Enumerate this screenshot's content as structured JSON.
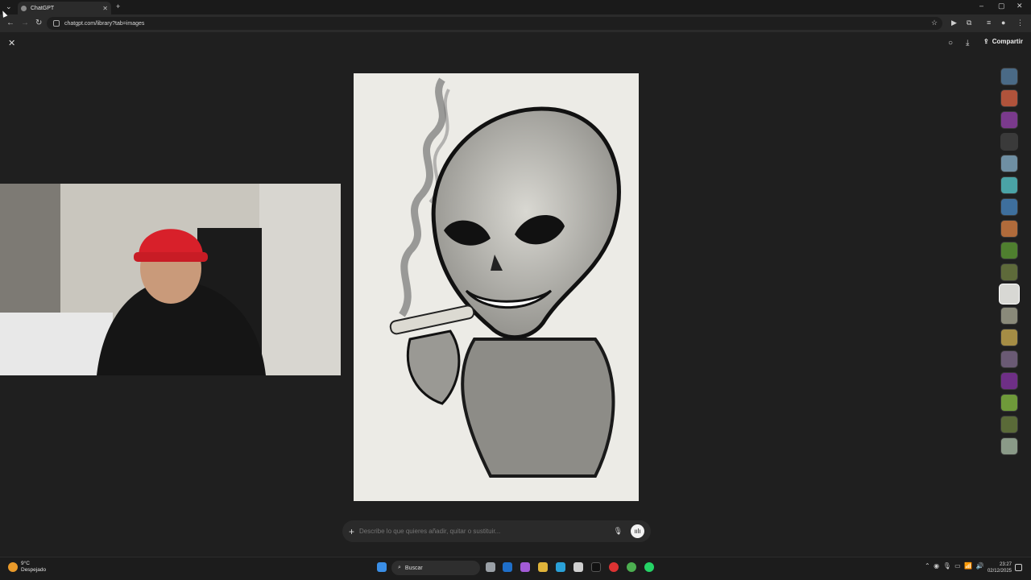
{
  "browser": {
    "tab_title": "ChatGPT",
    "tab_close": "✕",
    "new_tab": "+",
    "url": "chatgpt.com/library?tab=images",
    "window": {
      "minimize": "–",
      "maximize": "▢",
      "close": "✕"
    }
  },
  "viewer": {
    "close": "✕",
    "share_label": "Compartir",
    "prompt_placeholder": "Describe lo que quieres añadir, quitar o sustituir...",
    "thumbnails": [
      {
        "color": "#4a6a86"
      },
      {
        "color": "#b0533b"
      },
      {
        "color": "#7a3a8c"
      },
      {
        "color": "#3a3a3a"
      },
      {
        "color": "#6f8fa3"
      },
      {
        "color": "#4aa3a6"
      },
      {
        "color": "#3e6f9d"
      },
      {
        "color": "#b06b3b"
      },
      {
        "color": "#4f7f2f"
      },
      {
        "color": "#5e6a3a"
      },
      {
        "color": "#d8d8d4",
        "selected": true
      },
      {
        "color": "#8a8a7a"
      },
      {
        "color": "#a58d45"
      },
      {
        "color": "#6a5a74"
      },
      {
        "color": "#6e2f86"
      },
      {
        "color": "#6f9a3a"
      },
      {
        "color": "#5a6a38"
      },
      {
        "color": "#8a9a88"
      }
    ]
  },
  "taskbar": {
    "weather_temp": "9°C",
    "weather_desc": "Despejado",
    "search_label": "Buscar",
    "time": "23:27",
    "date": "02/12/2025"
  }
}
